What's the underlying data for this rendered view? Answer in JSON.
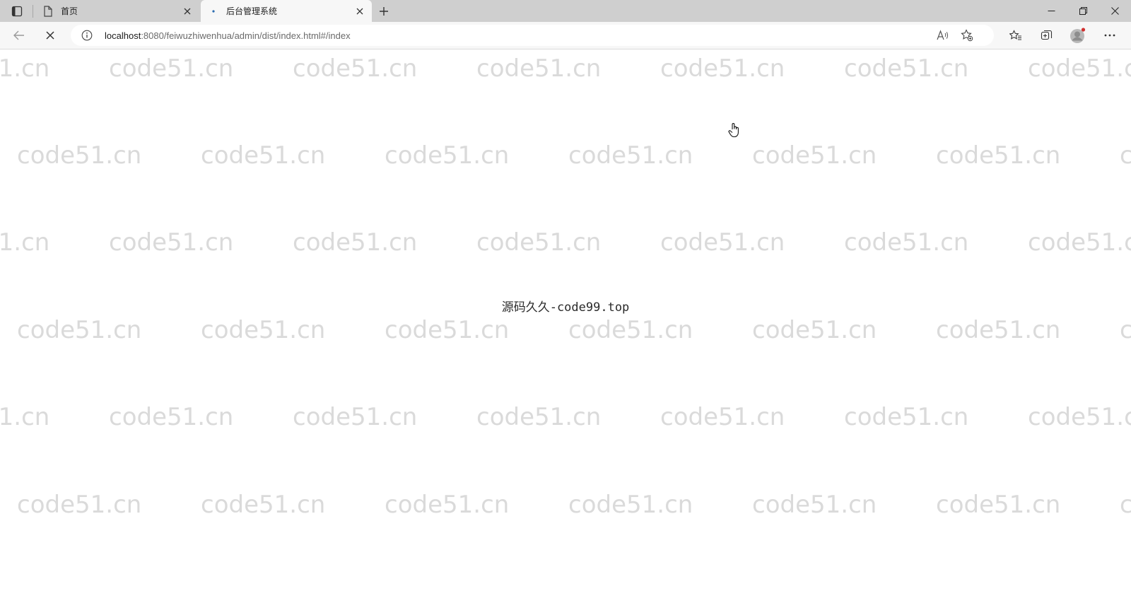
{
  "browser": {
    "tabs": [
      {
        "title": "首页",
        "active": false
      },
      {
        "title": "后台管理系统",
        "active": true
      }
    ],
    "address": {
      "host": "localhost",
      "rest": ":8080/feiwuzhiwenhua/admin/dist/index.html#/index"
    },
    "icons": {
      "tab_actions": "tab-actions-icon",
      "page": "page-icon",
      "loading": "loading-dot-icon",
      "close": "close-icon",
      "new_tab": "plus-icon",
      "back": "back-arrow-icon",
      "stop": "stop-icon",
      "info": "info-icon",
      "read_aloud": "read-aloud-icon",
      "add_favorite": "add-favorite-icon",
      "favorites": "favorites-icon",
      "collections": "collections-icon",
      "profile": "avatar-icon",
      "more": "more-icon",
      "minimize": "minimize-icon",
      "restore": "restore-icon",
      "window_close": "window-close-icon"
    }
  },
  "page": {
    "center_text": "源码久久-code99.top",
    "watermark": "code51.cn"
  },
  "colors": {
    "tabbar_bg": "#cfcfcf",
    "active_tab_bg": "#f7f7f7",
    "watermark": "#d4d4d4",
    "text": "#2a2a2a",
    "avatar_badge": "#d0302f"
  }
}
